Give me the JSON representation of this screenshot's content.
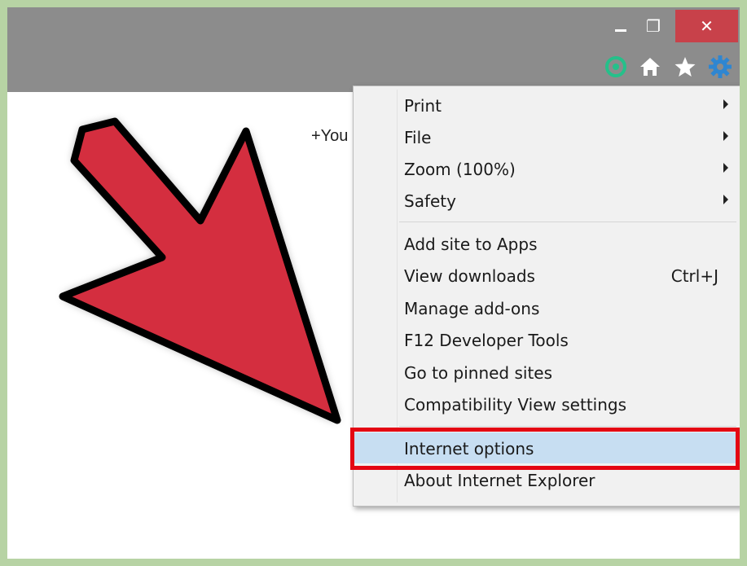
{
  "window": {
    "close_glyph": "✕",
    "restore_glyph": "❐"
  },
  "page": {
    "partial_text": "+You"
  },
  "toolbar": {
    "icons": [
      "skype-icon",
      "home-icon",
      "favorites-star-icon",
      "gear-icon"
    ]
  },
  "menu": {
    "items": [
      {
        "label": "Print",
        "submenu": true
      },
      {
        "label": "File",
        "submenu": true
      },
      {
        "label": "Zoom (100%)",
        "submenu": true
      },
      {
        "label": "Safety",
        "submenu": true
      },
      {
        "label": "Add site to Apps"
      },
      {
        "label": "View downloads",
        "shortcut": "Ctrl+J"
      },
      {
        "label": "Manage add-ons"
      },
      {
        "label": "F12 Developer Tools"
      },
      {
        "label": "Go to pinned sites"
      },
      {
        "label": "Compatibility View settings"
      },
      {
        "label": "Internet options",
        "highlighted": true
      },
      {
        "label": "About Internet Explorer"
      }
    ]
  },
  "colors": {
    "arrow_fill": "#d42e3f",
    "highlight_box": "#e40613",
    "selected_item_bg": "#c7def2",
    "titlebar": "#8c8c8c",
    "close_button": "#c8414a",
    "gear_icon": "#2f86d1",
    "skype_icon": "#25c08a"
  }
}
